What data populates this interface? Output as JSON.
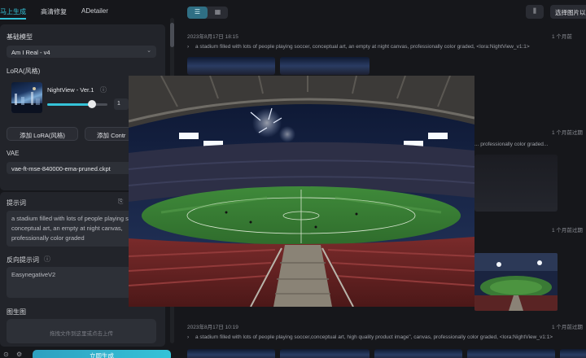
{
  "left_panel": {
    "tabs": [
      "马上生成",
      "高清修复",
      "ADetailer"
    ],
    "base_model": {
      "label": "基础模型",
      "value": "Am I Real - v4"
    },
    "lora": {
      "label": "LoRA(风格)",
      "name": "NightView - Ver.1",
      "weight": "1",
      "weight_fraction": 0.85,
      "add_lora_button": "添加 LoRA(风格)",
      "add_control_button": "添加 Contr"
    },
    "vae": {
      "label": "VAE",
      "value": "vae-ft-mse-840000-ema-pruned.ckpt"
    },
    "prompt": {
      "label": "提示词",
      "text": "a stadium filled with lots of people playing soccer,  conceptual art, an empty  at night canvas, professionally color graded"
    },
    "negative_prompt": {
      "label": "反向提示词",
      "value": "EasynegativeV2"
    },
    "image_to_image": {
      "label": "图生图",
      "upload_hint": "拖拽文件到这里或点击上传"
    },
    "generate_button": "立即生成"
  },
  "right_panel": {
    "select_images_button": "选择图片以",
    "entries": [
      {
        "date": "2023年8月17日 18:15",
        "right_label": "1 个月前",
        "prompt": "a stadium filled with lots of people playing soccer, conceptual art, an empty at night canvas, professionally color graded, <lora:NightView_v1:1>"
      },
      {
        "right_label": "1 个月前过期",
        "prompt": "... professionally color graded..."
      },
      {
        "right_label": "1 个月前过期"
      },
      {
        "date": "2023年8月17日 10:19",
        "right_label": "1 个月前过期",
        "prompt": "a stadium filled with lots of people playing soccer,conceptual art, high quality product image\", canvas, professionally color graded, <lora:NightView_v1:1>"
      }
    ]
  },
  "icons": {
    "info": "info-icon",
    "copy": "copy-icon",
    "list_view": "list-view-icon",
    "grid_view": "grid-view-icon",
    "chart": "chart-icon",
    "expand": "chevron-right-icon"
  },
  "colors": {
    "accent": "#35c3d8",
    "background": "#16171b",
    "card": "#22242a"
  }
}
